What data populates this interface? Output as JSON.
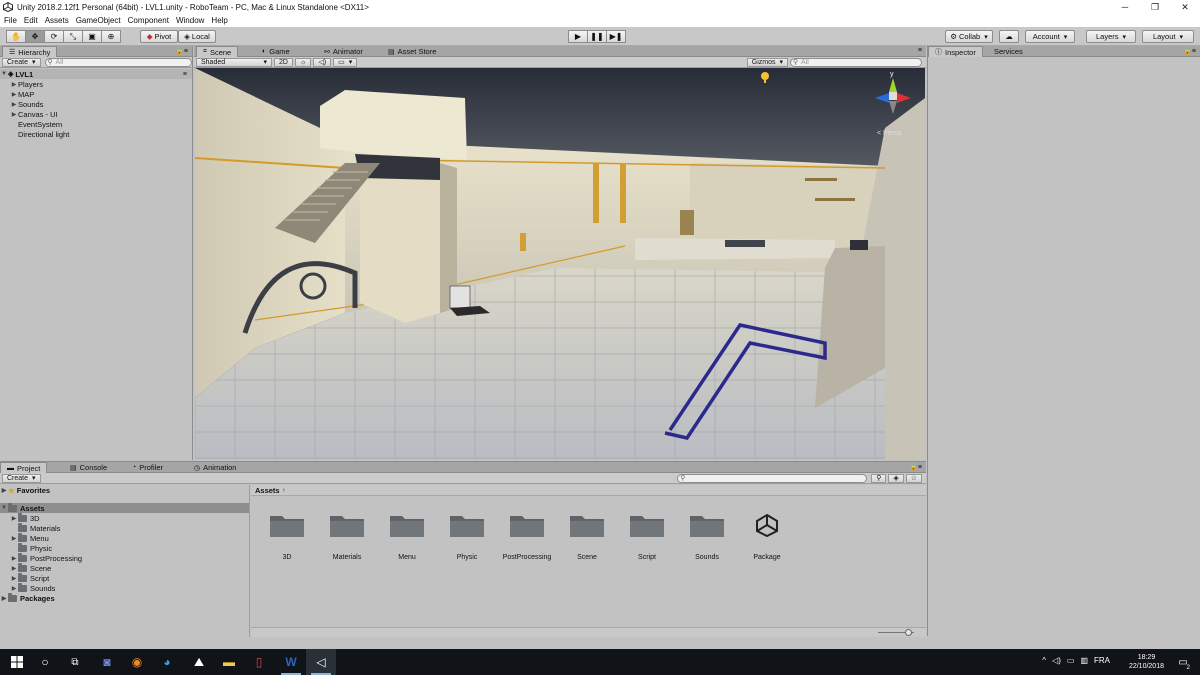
{
  "window": {
    "title": "Unity 2018.2.12f1 Personal (64bit) - LVL1.unity - RoboTeam - PC, Mac & Linux Standalone <DX11>",
    "controls": [
      "─",
      "❐",
      "✕"
    ]
  },
  "menubar": [
    "File",
    "Edit",
    "Assets",
    "GameObject",
    "Component",
    "Window",
    "Help"
  ],
  "toolbar": {
    "tools": [
      "hand-icon",
      "move-icon",
      "rotate-icon",
      "scale-icon",
      "rect-icon",
      "transform-icon"
    ],
    "pivot": "Pivot",
    "local": "Local",
    "play": "▶",
    "pause": "❚❚",
    "step": "▶❚",
    "collab": "Collab",
    "account": "Account",
    "layers": "Layers",
    "layout": "Layout"
  },
  "hierarchy": {
    "tab": "Hierarchy",
    "create": "Create",
    "search_placeholder": "All",
    "scene": "LVL1",
    "items": [
      {
        "label": "Players",
        "expandable": true
      },
      {
        "label": "MAP",
        "expandable": true
      },
      {
        "label": "Sounds",
        "expandable": true
      },
      {
        "label": "Canvas - UI",
        "expandable": true
      },
      {
        "label": "EventSystem",
        "expandable": false
      },
      {
        "label": "Directional light",
        "expandable": false
      }
    ]
  },
  "scene_tabs": {
    "scene": "Scene",
    "game": "Game",
    "animator": "Animator",
    "asset_store": "Asset Store",
    "shaded": "Shaded",
    "mode_2d": "2D",
    "gizmos": "Gizmos",
    "search_placeholder": "All",
    "persp": "Persp",
    "axis_y": "y"
  },
  "inspector": {
    "tab": "Inspector",
    "services": "Services"
  },
  "bottom_tabs": {
    "project": "Project",
    "console": "Console",
    "profiler": "Profiler",
    "animation": "Animation",
    "create": "Create"
  },
  "project_tree": {
    "favorites": "Favorites",
    "assets": "Assets",
    "folders": [
      "3D",
      "Materials",
      "Menu",
      "Physic",
      "PostProcessing",
      "Scene",
      "Script",
      "Sounds"
    ],
    "packages": "Packages"
  },
  "breadcrumb": {
    "root": "Assets",
    "sep": "›"
  },
  "assets_grid": [
    "3D",
    "Materials",
    "Menu",
    "Physic",
    "PostProcessing",
    "Scene",
    "Script",
    "Sounds",
    "Package"
  ],
  "taskbar": {
    "language": "FRA",
    "time": "18:29",
    "date": "22/10/2018",
    "notifications": "2"
  },
  "colors": {
    "panel_bg": "#c2c2c2",
    "tab_bg": "#a5a5a5",
    "selection": "#8e8e8e",
    "taskbar": "#101418",
    "folder": "#6a6e72"
  }
}
